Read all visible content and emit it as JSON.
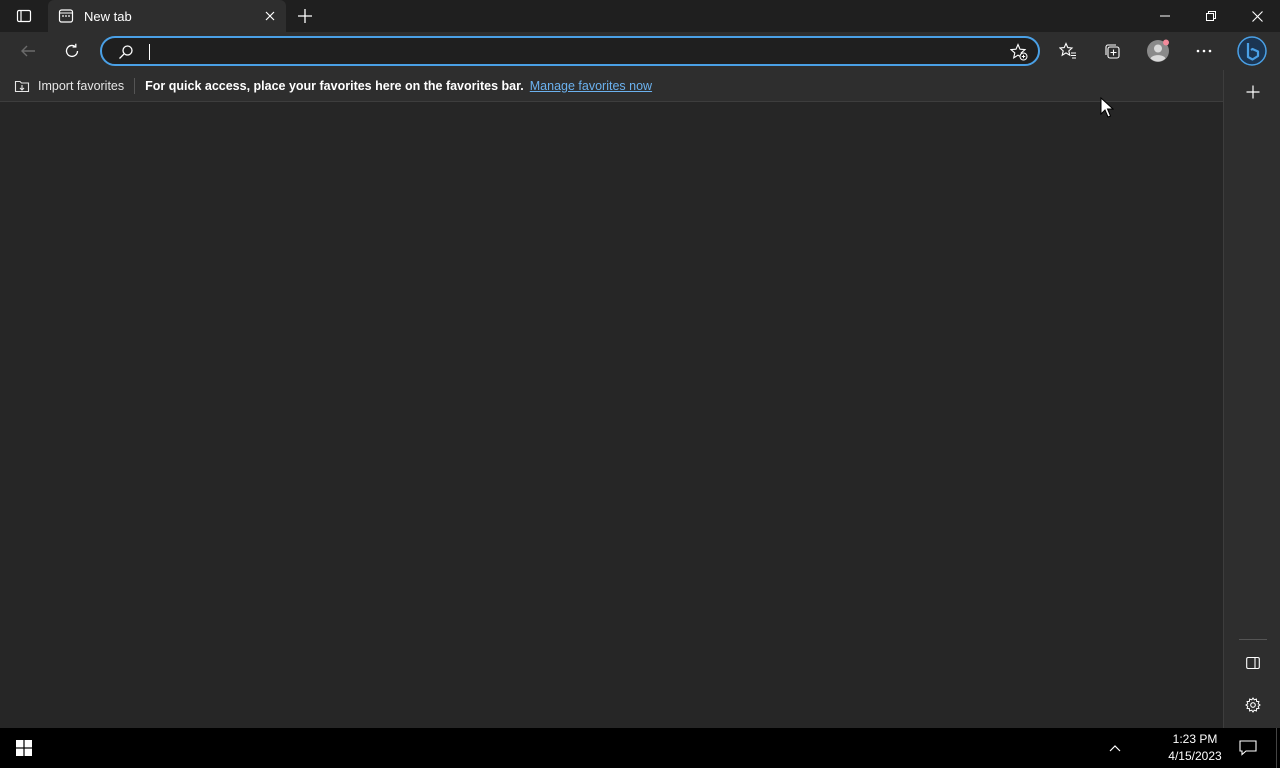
{
  "window": {
    "tab_actions_icon": "tab-actions-icon",
    "minimize_icon": "minimize-icon",
    "restore_icon": "restore-icon",
    "close_icon": "close-icon"
  },
  "tabs": [
    {
      "title": "New tab",
      "favicon": "new-tab-page-icon",
      "active": true
    }
  ],
  "toolbar": {
    "back_icon": "back-arrow-icon",
    "refresh_icon": "refresh-icon",
    "address_value": "",
    "address_placeholder": "",
    "favorites_icon": "favorites-icon",
    "collections_icon": "collections-icon",
    "profile_icon": "profile-avatar-icon",
    "more_icon": "more-options-icon",
    "bing_icon": "bing-chat-icon"
  },
  "favorites_bar": {
    "import_label": "Import favorites",
    "message": "For quick access, place your favorites here on the favorites bar.",
    "manage_link": "Manage favorites now"
  },
  "sidebar": {
    "add_icon": "plus-icon",
    "hide_sidebar_icon": "sidebar-toggle-icon",
    "settings_icon": "gear-icon"
  },
  "taskbar": {
    "time": "1:23 PM",
    "date": "4/15/2023"
  },
  "colors": {
    "accent": "#4aa0e6",
    "link": "#6bb1ee",
    "background": "#262626",
    "chrome": "#2e2e2e"
  }
}
